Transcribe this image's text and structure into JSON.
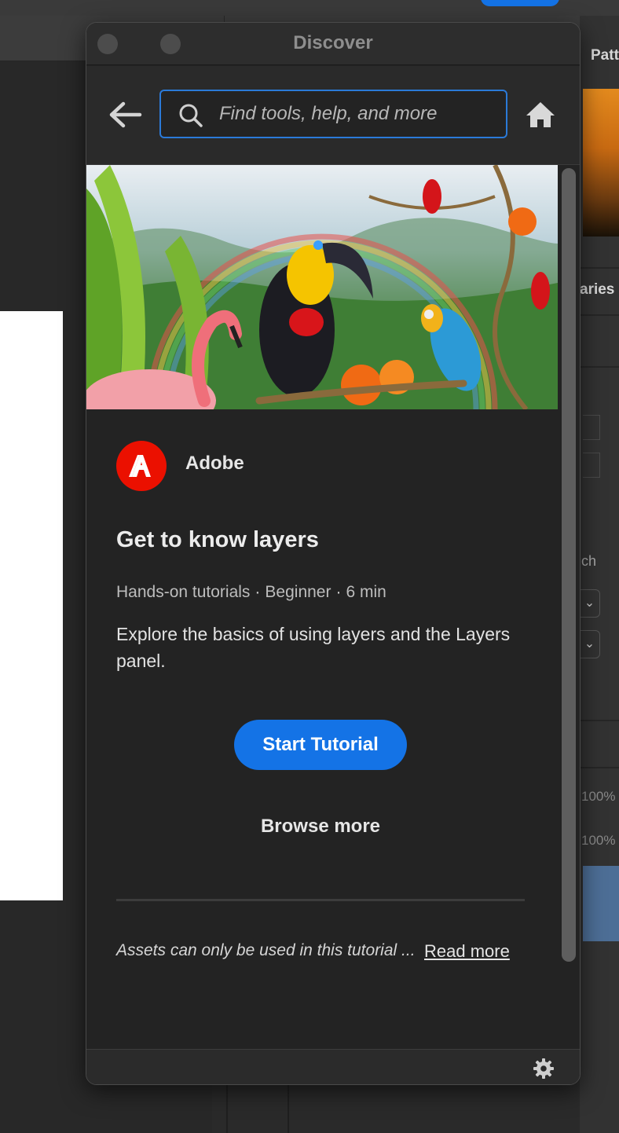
{
  "window": {
    "title": "Discover"
  },
  "search": {
    "placeholder": "Find tools, help, and more",
    "value": ""
  },
  "icons": {
    "back": "arrow-left-icon",
    "search": "search-icon",
    "home": "home-icon",
    "settings": "gear-icon",
    "author": "adobe-logo-icon"
  },
  "hero": {
    "description": "Tropical jungle illustration with toucan, parrots, flamingo and rainbow"
  },
  "tutorial": {
    "author": "Adobe",
    "title": "Get to know layers",
    "category": "Hands-on tutorials",
    "level": "Beginner",
    "duration": "6 min",
    "description": "Explore the basics of using layers and the Layers panel.",
    "start_label": "Start Tutorial",
    "browse_label": "Browse more",
    "notice": "Assets can only be used in this tutorial ...",
    "read_more_label": "Read more"
  },
  "background_app": {
    "panel_tab": "Patt",
    "panel_label": "aries",
    "field_label": "ch",
    "opacity_1": "100%",
    "opacity_2": "100%"
  },
  "colors": {
    "accent": "#1473e6",
    "adobe_red": "#eb1000",
    "panel_bg": "#232323",
    "focus_ring": "#2b7ad8"
  }
}
